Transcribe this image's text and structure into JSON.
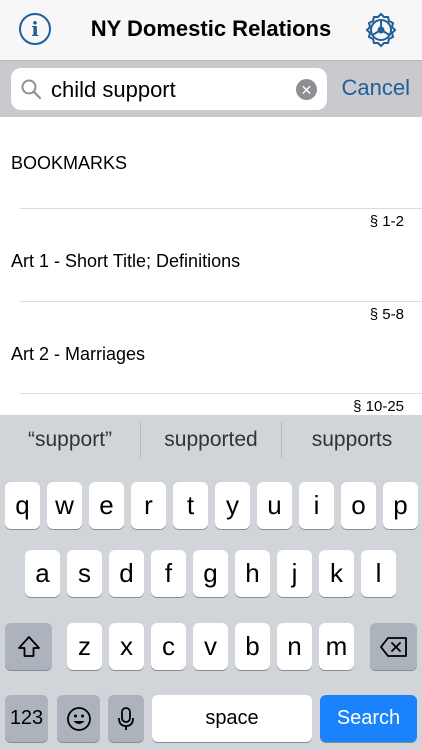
{
  "navbar": {
    "title": "NY Domestic Relations",
    "info_icon": "info-icon",
    "settings_icon": "gear-icon"
  },
  "search": {
    "query": "child support",
    "cancel_label": "Cancel"
  },
  "list": {
    "section_header": "BOOKMARKS",
    "rows": [
      {
        "range": "§ 1-2",
        "title": "Art 1 - Short Title; Definitions"
      },
      {
        "range": "§ 5-8",
        "title": "Art 2 - Marriages"
      },
      {
        "range": "§ 10-25",
        "title": ""
      }
    ]
  },
  "keyboard": {
    "suggestions": [
      "“support”",
      "supported",
      "supports"
    ],
    "row1": [
      "q",
      "w",
      "e",
      "r",
      "t",
      "y",
      "u",
      "i",
      "o",
      "p"
    ],
    "row2": [
      "a",
      "s",
      "d",
      "f",
      "g",
      "h",
      "j",
      "k",
      "l"
    ],
    "row3": [
      "z",
      "x",
      "c",
      "v",
      "b",
      "n",
      "m"
    ],
    "numbers_label": "123",
    "space_label": "space",
    "search_label": "Search"
  },
  "colors": {
    "accent": "#1f5f9a",
    "search_key": "#1a82fb",
    "keyboard_bg": "#d1d4d9"
  }
}
